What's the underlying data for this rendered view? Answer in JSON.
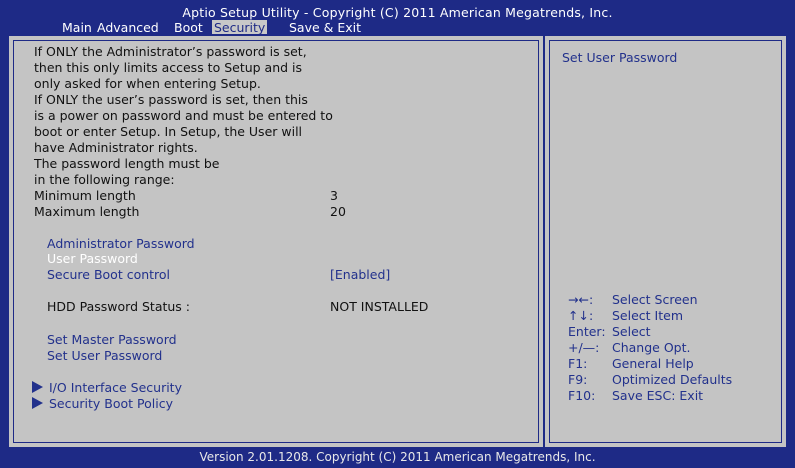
{
  "header": {
    "title": "Aptio Setup Utility - Copyright (C) 2011 American Megatrends, Inc.",
    "tabs": [
      "Main",
      "Advanced",
      "Boot",
      "Security",
      "Save & Exit"
    ]
  },
  "info": {
    "lines": [
      "If ONLY the Administrator’s password is set,",
      "then this only limits access to Setup and is",
      "only asked for when entering Setup.",
      "If ONLY the user’s password is set, then this",
      "is a power on password and must be entered to",
      "boot or enter Setup. In Setup, the User will",
      "have Administrator rights.",
      "The password length must be",
      "in the following range:"
    ],
    "min_label": "Minimum length",
    "min_value": "3",
    "max_label": "Maximum length",
    "max_value": "20"
  },
  "items": {
    "admin_password": "Administrator Password",
    "user_password": "User Password",
    "secure_boot_label": "Secure Boot control",
    "secure_boot_value": "[Enabled]",
    "hdd_status_label": "HDD Password Status :",
    "hdd_status_value": "NOT INSTALLED",
    "set_master": "Set Master Password",
    "set_user": "Set User Password",
    "io_security": "I/O Interface Security",
    "security_boot_policy": "Security Boot Policy"
  },
  "help": {
    "title": "Set User Password",
    "keys": [
      {
        "key": "→←:",
        "desc": "Select Screen",
        "icon": "left-right-arrows-icon"
      },
      {
        "key": "↑↓:",
        "desc": "Select Item",
        "icon": "up-down-arrows-icon"
      },
      {
        "key": "Enter:",
        "desc": "Select"
      },
      {
        "key": "+/—:",
        "desc": "Change Opt."
      },
      {
        "key": "F1:",
        "desc": "General Help"
      },
      {
        "key": "F9:",
        "desc": "Optimized Defaults"
      },
      {
        "key": "F10:",
        "desc": "Save   ESC: Exit"
      }
    ]
  },
  "footer": {
    "text": "Version 2.01.1208. Copyright (C) 2011 American Megatrends, Inc."
  },
  "colors": {
    "frame": "#1e2a86",
    "panel": "#c4c4c4",
    "link": "#22318c",
    "selected_text": "#ffffff"
  }
}
